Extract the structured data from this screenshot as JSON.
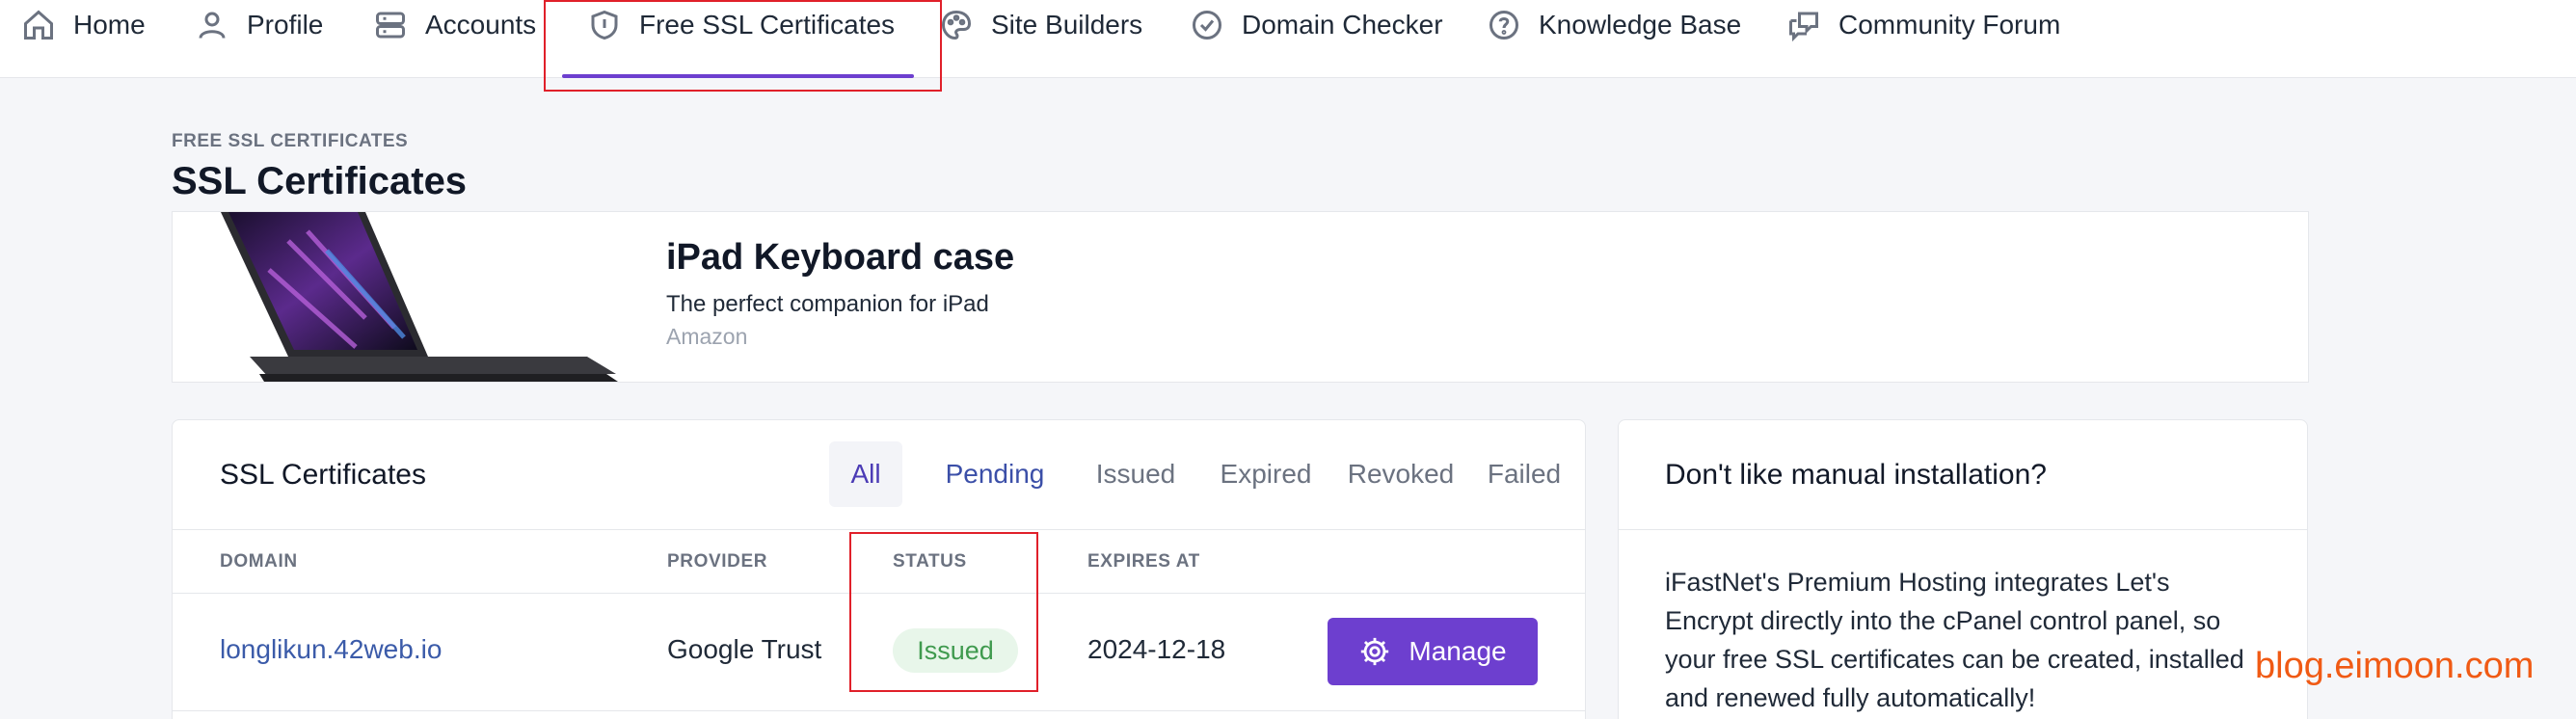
{
  "nav": {
    "items": [
      {
        "label": "Home",
        "icon": "home-icon"
      },
      {
        "label": "Profile",
        "icon": "user-icon"
      },
      {
        "label": "Accounts",
        "icon": "server-icon"
      },
      {
        "label": "Free SSL Certificates",
        "icon": "shield-icon"
      },
      {
        "label": "Site Builders",
        "icon": "palette-icon"
      },
      {
        "label": "Domain Checker",
        "icon": "check-circle-icon"
      },
      {
        "label": "Knowledge Base",
        "icon": "question-circle-icon"
      },
      {
        "label": "Community Forum",
        "icon": "chat-icon"
      }
    ],
    "active": "Free SSL Certificates"
  },
  "header": {
    "breadcrumb": "FREE SSL CERTIFICATES",
    "title": "SSL Certificates"
  },
  "ad": {
    "title": "iPad Keyboard case",
    "subtitle": "The perfect companion for iPad",
    "source": "Amazon"
  },
  "ssl": {
    "title": "SSL Certificates",
    "tabs": [
      "All",
      "Pending",
      "Issued",
      "Expired",
      "Revoked",
      "Failed"
    ],
    "active_tab": "All",
    "columns": [
      "DOMAIN",
      "PROVIDER",
      "STATUS",
      "EXPIRES AT"
    ],
    "rows": [
      {
        "domain": "longlikun.42web.io",
        "provider": "Google Trust",
        "status": "Issued",
        "expires": "2024-12-18",
        "action": "Manage"
      }
    ]
  },
  "side": {
    "title": "Don't like manual installation?",
    "text": "iFastNet's Premium Hosting integrates Let's Encrypt directly into the cPanel control panel, so your free SSL certificates can be created, installed and renewed fully automatically!"
  },
  "watermark": "blog.eimoon.com",
  "colors": {
    "accent": "#6d3fcf",
    "link": "#3b5ba9",
    "success_bg": "#e8f6ea",
    "success_text": "#3f9a4e",
    "highlight": "#e0202a",
    "watermark": "#f05a14"
  }
}
